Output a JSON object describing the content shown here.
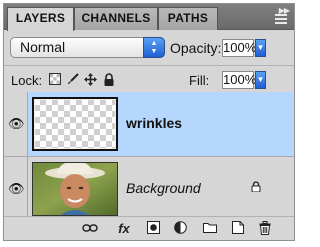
{
  "tabs": [
    {
      "label": "LAYERS"
    },
    {
      "label": "CHANNELS"
    },
    {
      "label": "PATHS"
    }
  ],
  "panel_controls": {
    "collapse_icon": "double-chevron-icon",
    "menu_icon": "panel-menu-icon"
  },
  "blend_mode": {
    "value": "Normal"
  },
  "opacity": {
    "label": "Opacity:",
    "value": "100%"
  },
  "lock": {
    "label": "Lock:",
    "icons": [
      "lock-transparent-pixels-icon",
      "lock-image-pixels-icon",
      "lock-position-icon",
      "lock-all-icon"
    ]
  },
  "fill": {
    "label": "Fill:",
    "value": "100%"
  },
  "layers": [
    {
      "name": "wrinkles",
      "selected": true,
      "visible": true,
      "thumbnail": "transparent-checkerboard"
    },
    {
      "name": "Background",
      "selected": false,
      "visible": true,
      "locked": true,
      "thumbnail": "photo-man-in-cowboy-hat"
    }
  ],
  "bottom_toolbar": {
    "icons": [
      "link-layers-icon",
      "fx-icon",
      "layer-mask-icon",
      "adjustment-layer-icon",
      "new-group-icon",
      "new-layer-icon",
      "trash-icon"
    ],
    "fx_label": "fx"
  },
  "colors": {
    "selection": "#b5d7fd",
    "panel": "#d6d6d6",
    "accent": "#2a6fdb"
  }
}
